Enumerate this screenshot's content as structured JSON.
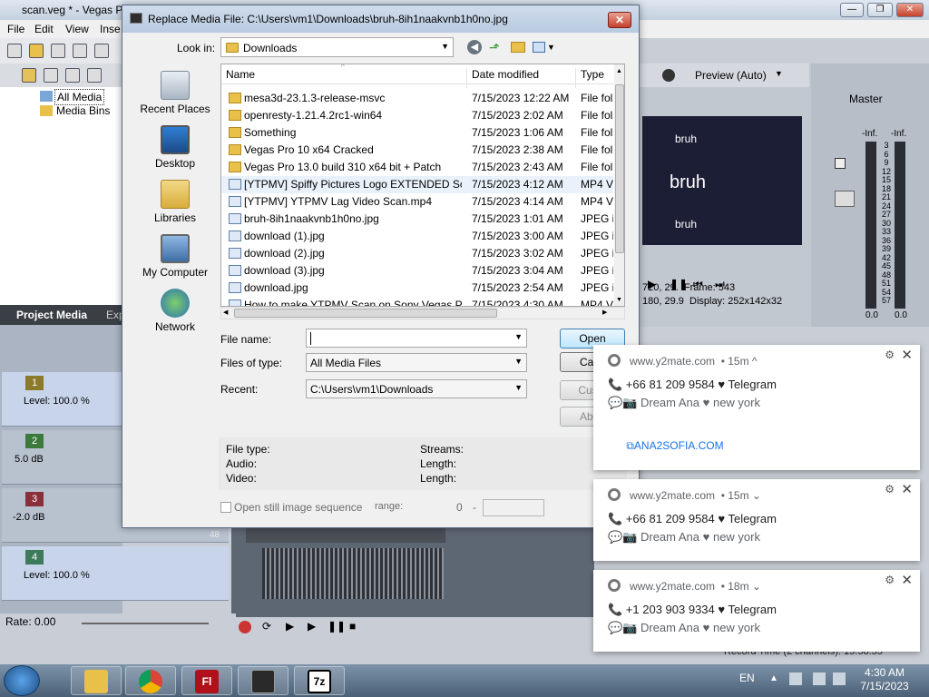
{
  "vegas": {
    "title": "scan.veg * - Vegas P",
    "menu": [
      "File",
      "Edit",
      "View",
      "Inse"
    ],
    "media_tree": {
      "all_media": "All Media",
      "media_bins": "Media Bins"
    },
    "project_tabs": {
      "active": "Project Media",
      "other": "Exp"
    },
    "tracks": [
      {
        "num": "1",
        "level": "Level: 100.0 %"
      },
      {
        "num": "2",
        "level": "5.0 dB"
      },
      {
        "num": "3",
        "level": "-2.0 dB"
      },
      {
        "num": "4",
        "level": "Level: 100.0 %"
      }
    ],
    "rate": "Rate: 0.00",
    "preview": {
      "label": "Preview (Auto)",
      "text_top": "bruh",
      "text_mid": "bruh",
      "text_bot": "bruh"
    },
    "info": {
      "res1": "720, 29.",
      "res2": "180, 29.9",
      "frame_label": "Frame:",
      "frame_value": "543",
      "display_label": "Display:",
      "display_value": "252x142x32"
    },
    "mixer": {
      "master": "Master",
      "left_top": "-Inf.",
      "right_top": "-Inf.",
      "scale": [
        "3",
        "6",
        "9",
        "12",
        "15",
        "18",
        "21",
        "24",
        "27",
        "30",
        "33",
        "36",
        "39",
        "42",
        "45",
        "48",
        "51",
        "54",
        "57"
      ],
      "left_bottom": "0.0",
      "right_bottom": "0.0"
    },
    "timeline_marker": "48",
    "record_time": "Record Time (2 channels): 15:58:55"
  },
  "dialog": {
    "title": "Replace Media File: C:\\Users\\vm1\\Downloads\\bruh-8ih1naakvnb1h0no.jpg",
    "close": "✕",
    "look_in_label": "Look in:",
    "look_in_value": "Downloads",
    "places": [
      "Recent Places",
      "Desktop",
      "Libraries",
      "My Computer",
      "Network"
    ],
    "columns": {
      "name": "Name",
      "date": "Date modified",
      "type": "Type"
    },
    "files": [
      {
        "name": "mesa3d-23.1.3-release-msvc",
        "date": "7/15/2023 12:22 AM",
        "type": "File fol",
        "kind": "folder"
      },
      {
        "name": "openresty-1.21.4.2rc1-win64",
        "date": "7/15/2023 2:02 AM",
        "type": "File fol",
        "kind": "folder"
      },
      {
        "name": "Something",
        "date": "7/15/2023 1:06 AM",
        "type": "File fol",
        "kind": "folder"
      },
      {
        "name": "Vegas Pro 10 x64 Cracked",
        "date": "7/15/2023 2:38 AM",
        "type": "File fol",
        "kind": "folder"
      },
      {
        "name": "Vegas Pro 13.0 build 310 x64 bit + Patch",
        "date": "7/15/2023 2:43 AM",
        "type": "File fol",
        "kind": "folder"
      },
      {
        "name": "[YTPMV] Spiffy Pictures Logo EXTENDED Sc...",
        "date": "7/15/2023 4:12 AM",
        "type": "MP4 V",
        "kind": "video"
      },
      {
        "name": "[YTPMV] YTPMV Lag Video Scan.mp4",
        "date": "7/15/2023 4:14 AM",
        "type": "MP4 V",
        "kind": "video"
      },
      {
        "name": "bruh-8ih1naakvnb1h0no.jpg",
        "date": "7/15/2023 1:01 AM",
        "type": "JPEG in",
        "kind": "image"
      },
      {
        "name": "download (1).jpg",
        "date": "7/15/2023 3:00 AM",
        "type": "JPEG in",
        "kind": "image"
      },
      {
        "name": "download (2).jpg",
        "date": "7/15/2023 3:02 AM",
        "type": "JPEG in",
        "kind": "image"
      },
      {
        "name": "download (3).jpg",
        "date": "7/15/2023 3:04 AM",
        "type": "JPEG in",
        "kind": "image"
      },
      {
        "name": "download.jpg",
        "date": "7/15/2023 2:54 AM",
        "type": "JPEG in",
        "kind": "image"
      },
      {
        "name": "How to make YTPMV Scan on Sony Vegas P...",
        "date": "7/15/2023 4:30 AM",
        "type": "MP4 V",
        "kind": "video"
      }
    ],
    "file_name_label": "File name:",
    "file_name_value": "",
    "files_of_type_label": "Files of type:",
    "files_of_type_value": "All Media Files",
    "recent_label": "Recent:",
    "recent_value": "C:\\Users\\vm1\\Downloads",
    "buttons": {
      "open": "Open",
      "cancel": "Canc",
      "custom": "Custo",
      "about": "Abou"
    },
    "info": {
      "file_type": "File type:",
      "audio": "Audio:",
      "video": "Video:",
      "streams": "Streams:",
      "length1": "Length:",
      "length2": "Length:"
    },
    "still_sequence": "Open still image sequence",
    "range_label": "range:",
    "range_start": "0",
    "range_sep": "-"
  },
  "notifications": [
    {
      "source": "www.y2mate.com",
      "time": "• 15m ^",
      "line1": "📞 +66 81 209 9584 ♥ Telegram",
      "line2": "💬📷 Dream Ana ♥ new york",
      "link": "⧉ANA2SOFIA.COM"
    },
    {
      "source": "www.y2mate.com",
      "time": "• 15m ⌄",
      "line1": "📞 +66 81 209 9584 ♥ Telegram",
      "line2": "💬📷 Dream Ana ♥ new york"
    },
    {
      "source": "www.y2mate.com",
      "time": "• 18m ⌄",
      "line1": "📞 +1 203 903 9334 ♥ Telegram",
      "line2": "💬📷 Dream Ana ♥ new york"
    }
  ],
  "taskbar": {
    "lang": "EN",
    "time": "4:30 AM",
    "date": "7/15/2023",
    "apps": [
      "explorer",
      "chrome",
      "flash",
      "vegas",
      "7zip"
    ],
    "flash_label": "Fl",
    "zip_label": "7z"
  },
  "colors": {
    "accent": "#3c7fb1",
    "preview_bg": "#1c1e36",
    "folder": "#e8c04a"
  }
}
